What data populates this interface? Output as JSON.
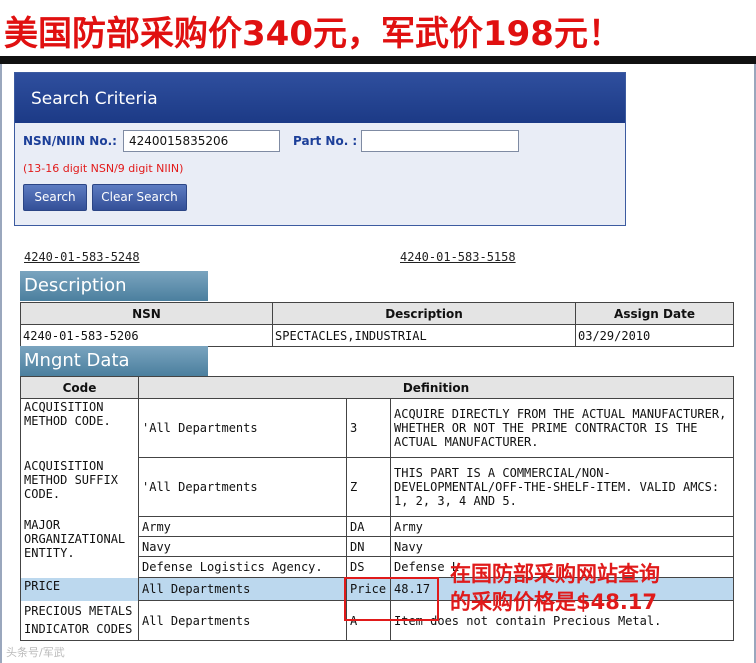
{
  "banner": {
    "text": "美国防部采购价340元，军武价198元！"
  },
  "search": {
    "title": "Search Criteria",
    "nsn_label": "NSN/NIIN No.:",
    "nsn_value": "4240015835206",
    "part_label": "Part No. :",
    "part_value": "",
    "hint": "(13-16 digit NSN/9 digit NIIN)",
    "search_button": "Search",
    "clear_button": "Clear Search"
  },
  "links": {
    "prev": "4240-01-583-5248",
    "next": "4240-01-583-5158"
  },
  "description": {
    "heading": "Description",
    "columns": [
      "NSN",
      "Description",
      "Assign Date"
    ],
    "row": {
      "nsn": "4240-01-583-5206",
      "description": "SPECTACLES,INDUSTRIAL",
      "assign_date": "03/29/2010"
    }
  },
  "mgmt": {
    "heading": "Mngnt Data",
    "col_code": "Code",
    "col_definition": "Definition",
    "rows": {
      "acq_method": {
        "code": "ACQUISITION METHOD CODE.",
        "dept": "'All Departments",
        "val": "3",
        "def": "ACQUIRE DIRECTLY FROM THE ACTUAL MANUFACTURER, WHETHER OR NOT THE PRIME CONTRACTOR IS THE ACTUAL MANUFACTURER."
      },
      "acq_suffix": {
        "code": "ACQUISITION METHOD SUFFIX CODE.",
        "dept": "'All Departments",
        "val": "Z",
        "def": "THIS PART IS A COMMERCIAL/NON-DEVELOPMENTAL/OFF-THE-SHELF-ITEM. VALID AMCS: 1, 2, 3, 4 AND 5."
      },
      "major_org": {
        "code": "MAJOR ORGANIZATIONAL ENTITY.",
        "army_dept": "Army",
        "army_val": "DA",
        "army_def": "Army",
        "navy_dept": "Navy",
        "navy_val": "DN",
        "navy_def": "Navy",
        "dla_dept": "Defense Logistics Agency.",
        "dla_val": "DS",
        "dla_def": "Defense L"
      },
      "price": {
        "code": "PRICE",
        "dept": "All Departments",
        "val": "Price",
        "def": "48.17"
      },
      "precious": {
        "code": "PRECIOUS METALS INDICATOR CODES",
        "dept": "All Departments",
        "val": "A",
        "def": "Item does not contain Precious Metal."
      }
    }
  },
  "annotation": {
    "line1": "在国防部采购网站查询",
    "line2": "的采购价格是$48.17",
    "color": "#e01a1a"
  },
  "watermark": "头条号/军武"
}
